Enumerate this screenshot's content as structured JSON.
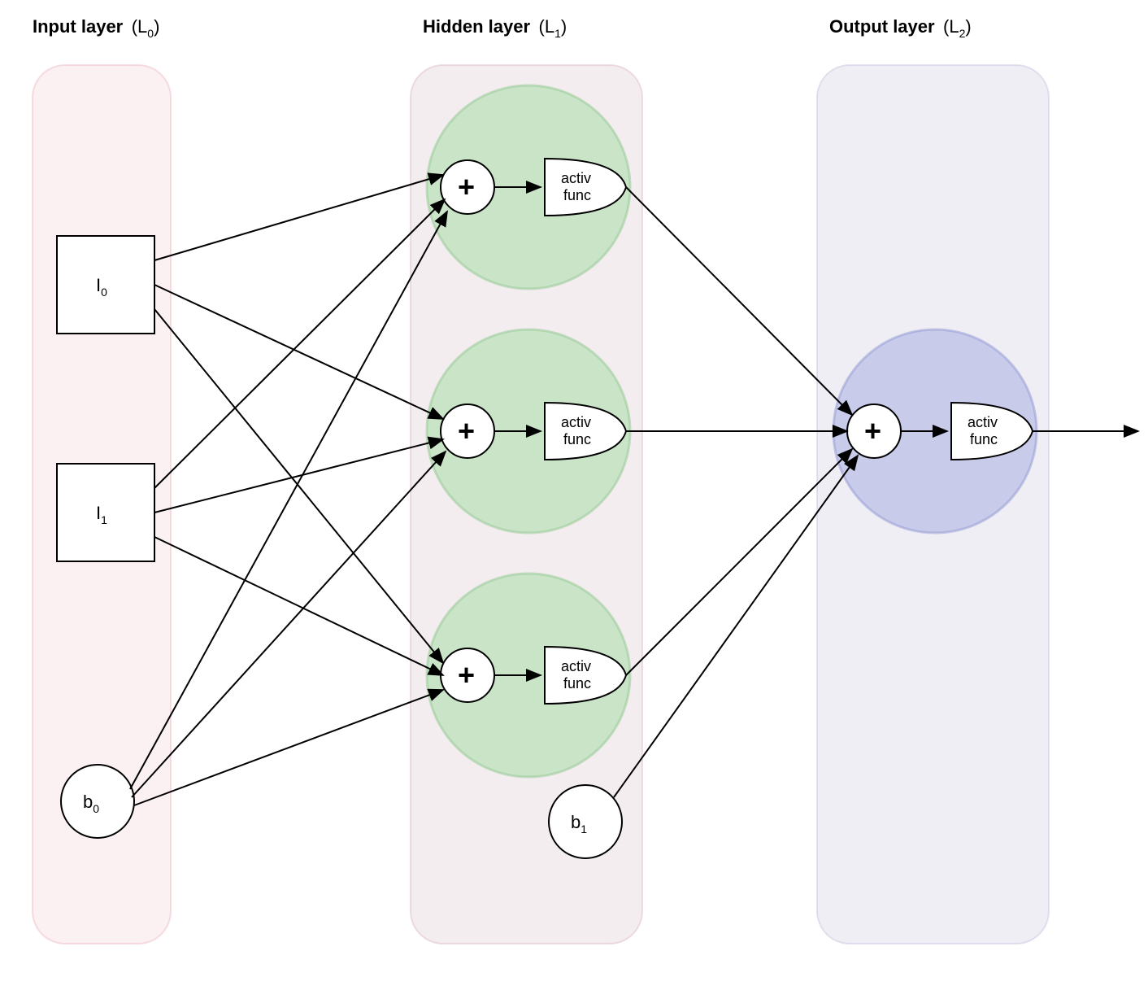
{
  "diagram": {
    "layers": {
      "input": {
        "title": "Input layer",
        "sub": "(L",
        "subIndex": "0",
        "subClose": ")"
      },
      "hidden": {
        "title": "Hidden layer",
        "sub": "(L",
        "subIndex": "1",
        "subClose": ")"
      },
      "output": {
        "title": "Output layer",
        "sub": "(L",
        "subIndex": "2",
        "subClose": ")"
      }
    },
    "inputs": {
      "i0": {
        "label": "I",
        "index": "0"
      },
      "i1": {
        "label": "I",
        "index": "1"
      },
      "b0": {
        "label": "b",
        "index": "0"
      }
    },
    "hidden": {
      "sum": "+",
      "activ1": "activ",
      "activ2": "func",
      "b1": {
        "label": "b",
        "index": "1"
      }
    },
    "output": {
      "sum": "+",
      "activ1": "activ",
      "activ2": "func"
    }
  }
}
